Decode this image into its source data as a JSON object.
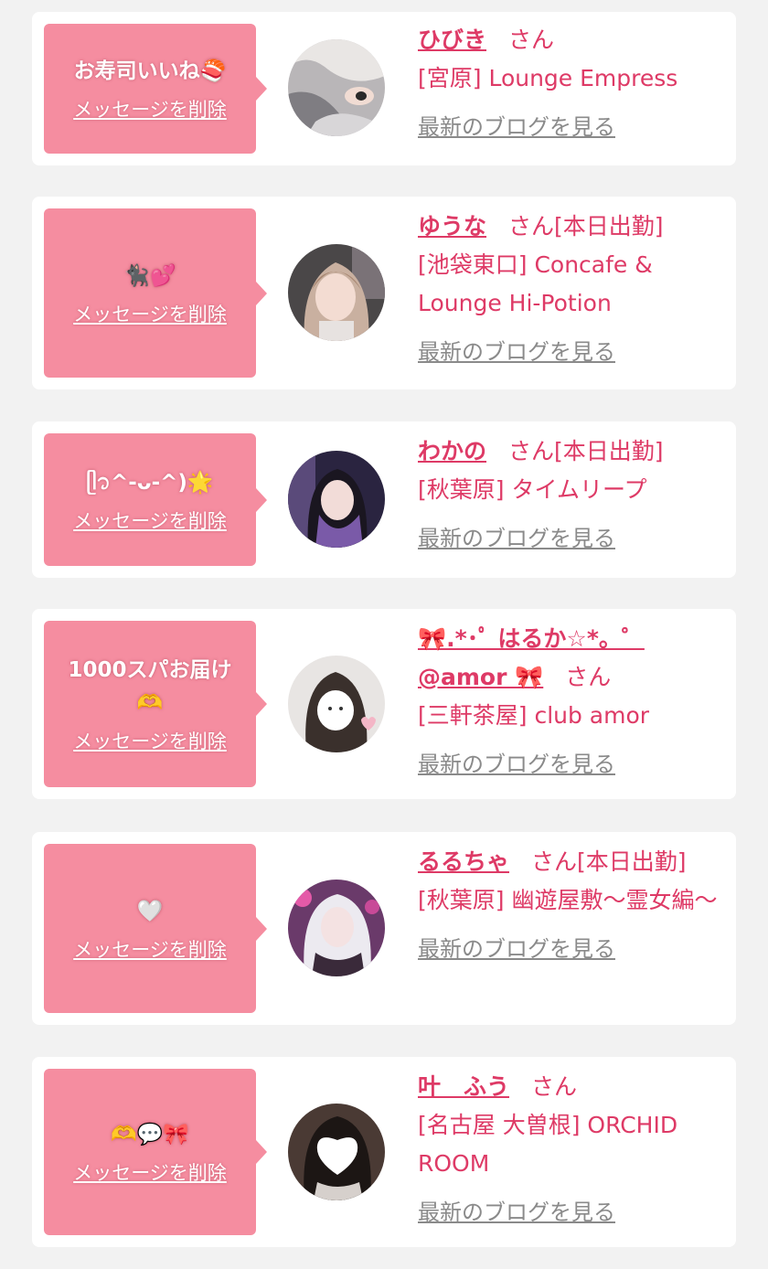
{
  "delete_label": "メッセージを削除",
  "honorific": "さん",
  "blog_label": "最新のブログを見る",
  "colors": {
    "accent": "#de3a66",
    "bubble": "#f58da0",
    "card": "#ffffff",
    "background": "#f2f2f2",
    "link_gray": "#8a8a8a"
  },
  "cards": [
    {
      "message": "お寿司いいね🍣",
      "name": "ひびき",
      "attendance": "",
      "shop": "[宮原] Lounge Empress"
    },
    {
      "message": "🐈‍⬛💕",
      "name": "ゆうな",
      "attendance": "[本日出勤]",
      "shop": "[池袋東口] Concafe & Lounge Hi-Potion"
    },
    {
      "message": "ᥫ᭡^-ᴗ-^)🌟",
      "name": "わかの",
      "attendance": "[本日出勤]",
      "shop": "[秋葉原] タイムリープ"
    },
    {
      "message": "1000スパお届け🫶",
      "name": "🎀.*･ﾟ はるか☆*。゜@amor 🎀",
      "attendance": "",
      "shop": "[三軒茶屋] club amor"
    },
    {
      "message": "🤍",
      "name": "るるちゃ",
      "attendance": "[本日出勤]",
      "shop": "[秋葉原] 幽遊屋敷〜霊女編〜"
    },
    {
      "message": "🫶💬🎀",
      "name": "叶　ふう",
      "attendance": "",
      "shop": "[名古屋 大曽根] ORCHID ROOM"
    }
  ]
}
